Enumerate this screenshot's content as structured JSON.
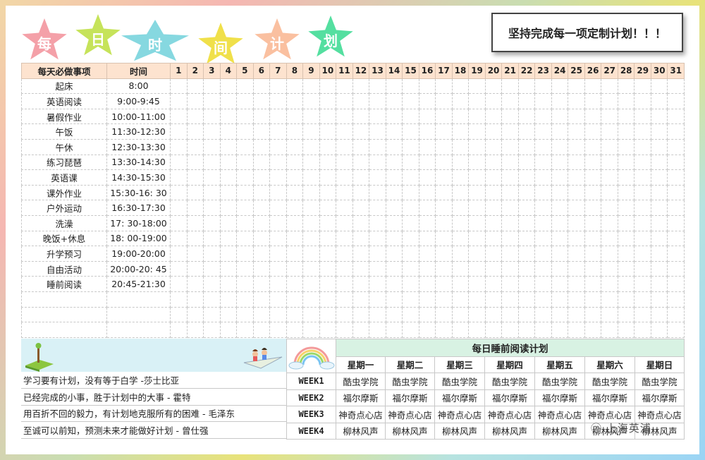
{
  "stars": [
    {
      "char": "每",
      "color": "#f4a0a8"
    },
    {
      "char": "日",
      "color": "#c6e35a"
    },
    {
      "char": "时",
      "color": "#86d8e0"
    },
    {
      "char": "间",
      "color": "#f0e04a"
    },
    {
      "char": "计",
      "color": "#fac0a0"
    },
    {
      "char": "划",
      "color": "#54dfa0"
    }
  ],
  "motto": "坚持完成每一项定制计划！！！",
  "schedule": {
    "col_item": "每天必做事项",
    "col_time": "时间",
    "days": [
      "1",
      "2",
      "3",
      "4",
      "5",
      "6",
      "7",
      "8",
      "9",
      "10",
      "11",
      "12",
      "13",
      "14",
      "15",
      "16",
      "17",
      "18",
      "19",
      "20",
      "21",
      "22",
      "23",
      "24",
      "25",
      "26",
      "27",
      "28",
      "29",
      "30",
      "31"
    ],
    "rows": [
      {
        "item": "起床",
        "time": "8:00"
      },
      {
        "item": "英语阅读",
        "time": "9:00-9:45"
      },
      {
        "item": "暑假作业",
        "time": "10:00-11:00"
      },
      {
        "item": "午饭",
        "time": "11:30-12:30"
      },
      {
        "item": "午休",
        "time": "12:30-13:30"
      },
      {
        "item": "练习琵琶",
        "time": "13:30-14:30"
      },
      {
        "item": "英语课",
        "time": "14:30-15:30"
      },
      {
        "item": "课外作业",
        "time": "15:30-16: 30"
      },
      {
        "item": "户外运动",
        "time": "16:30-17:30"
      },
      {
        "item": "洗澡",
        "time": "17: 30-18:00"
      },
      {
        "item": "晚饭+休息",
        "time": "18: 00-19:00"
      },
      {
        "item": "升学预习",
        "time": "19:00-20:00"
      },
      {
        "item": "自由活动",
        "time": "20:00-20: 45"
      },
      {
        "item": "睡前阅读",
        "time": "20:45-21:30"
      },
      {
        "item": "",
        "time": ""
      },
      {
        "item": "",
        "time": ""
      },
      {
        "item": "",
        "time": ""
      }
    ]
  },
  "quotes": [
    "学习要有计划，没有等于白学 -莎士比亚",
    "已经完成的小事，胜于计划中的大事 - 霍特",
    "用百折不回的毅力，有计划地克服所有的困难 - 毛泽东",
    "至诚可以前知，预测未来才能做好计划 - 曾仕强"
  ],
  "reading": {
    "title": "每日睡前阅读计划",
    "weekdays": [
      "星期一",
      "星期二",
      "星期三",
      "星期四",
      "星期五",
      "星期六",
      "星期日"
    ],
    "weeks": [
      {
        "label": "WEEK1",
        "books": [
          "酷虫学院",
          "酷虫学院",
          "酷虫学院",
          "酷虫学院",
          "酷虫学院",
          "酷虫学院",
          "酷虫学院"
        ]
      },
      {
        "label": "WEEK2",
        "books": [
          "福尔摩斯",
          "福尔摩斯",
          "福尔摩斯",
          "福尔摩斯",
          "福尔摩斯",
          "福尔摩斯",
          "福尔摩斯"
        ]
      },
      {
        "label": "WEEK3",
        "books": [
          "神奇点心店",
          "神奇点心店",
          "神奇点心店",
          "神奇点心店",
          "神奇点心店",
          "神奇点心店",
          "神奇点心店"
        ]
      },
      {
        "label": "WEEK4",
        "books": [
          "柳林风声",
          "柳林风声",
          "柳林风声",
          "柳林风声",
          "柳林风声",
          "柳林风声",
          "柳林风声"
        ]
      }
    ]
  },
  "watermark": "上海英浦"
}
